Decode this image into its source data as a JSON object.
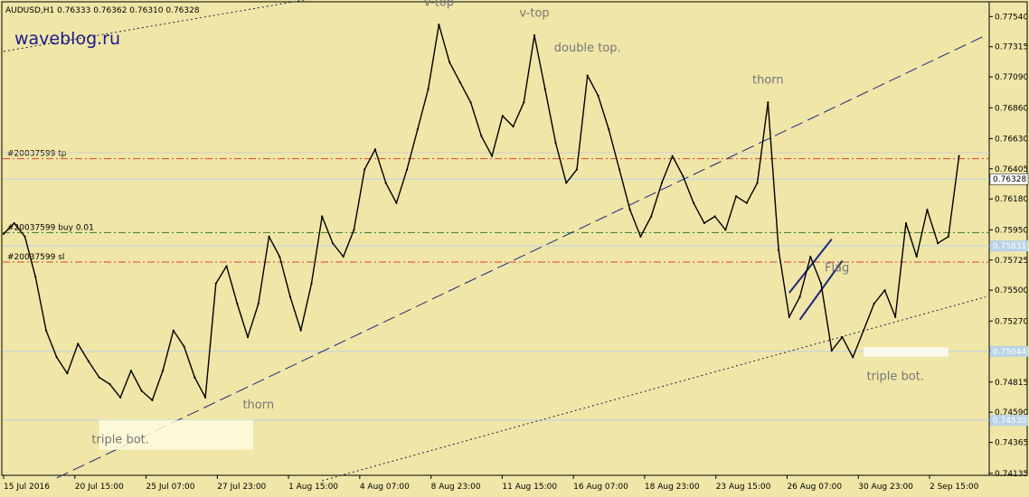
{
  "header": {
    "symbol_line": "AUDUSD,H1  0.76333 0.76362 0.76310 0.76328",
    "watermark": "waveblog.ru"
  },
  "chart_data": {
    "type": "line",
    "title": "AUDUSD,H1",
    "ohlc_last": {
      "open": 0.76333,
      "high": 0.76362,
      "low": 0.7631,
      "close": 0.76328
    },
    "ylim": [
      0.7412,
      0.7765
    ],
    "y_ticks": [
      "0.77540",
      "0.77315",
      "0.77090",
      "0.76860",
      "0.76630",
      "0.76405",
      "0.76180",
      "0.75950",
      "0.75725",
      "0.75500",
      "0.75270",
      "0.75045",
      "0.74815",
      "0.74590",
      "0.74365",
      "0.74135"
    ],
    "x_ticks": [
      "15 Jul 2016",
      "20 Jul 15:00",
      "25 Jul 07:00",
      "27 Jul 23:00",
      "1 Aug 15:00",
      "4 Aug 07:00",
      "8 Aug 23:00",
      "11 Aug 15:00",
      "16 Aug 07:00",
      "18 Aug 23:00",
      "23 Aug 15:00",
      "26 Aug 07:00",
      "30 Aug 23:00",
      "2 Sep 15:00"
    ],
    "price_series": [
      {
        "t": 0,
        "v": 0.7592
      },
      {
        "t": 2,
        "v": 0.76
      },
      {
        "t": 4,
        "v": 0.759
      },
      {
        "t": 6,
        "v": 0.756
      },
      {
        "t": 8,
        "v": 0.752
      },
      {
        "t": 10,
        "v": 0.75
      },
      {
        "t": 12,
        "v": 0.7488
      },
      {
        "t": 14,
        "v": 0.751
      },
      {
        "t": 16,
        "v": 0.7497
      },
      {
        "t": 18,
        "v": 0.7485
      },
      {
        "t": 20,
        "v": 0.748
      },
      {
        "t": 22,
        "v": 0.747
      },
      {
        "t": 24,
        "v": 0.749
      },
      {
        "t": 26,
        "v": 0.7475
      },
      {
        "t": 28,
        "v": 0.7468
      },
      {
        "t": 30,
        "v": 0.749
      },
      {
        "t": 32,
        "v": 0.752
      },
      {
        "t": 34,
        "v": 0.7508
      },
      {
        "t": 36,
        "v": 0.7485
      },
      {
        "t": 38,
        "v": 0.747
      },
      {
        "t": 40,
        "v": 0.7555
      },
      {
        "t": 42,
        "v": 0.7568
      },
      {
        "t": 44,
        "v": 0.754
      },
      {
        "t": 46,
        "v": 0.7515
      },
      {
        "t": 48,
        "v": 0.754
      },
      {
        "t": 50,
        "v": 0.759
      },
      {
        "t": 52,
        "v": 0.7575
      },
      {
        "t": 54,
        "v": 0.7545
      },
      {
        "t": 56,
        "v": 0.752
      },
      {
        "t": 58,
        "v": 0.7555
      },
      {
        "t": 60,
        "v": 0.7605
      },
      {
        "t": 62,
        "v": 0.7585
      },
      {
        "t": 64,
        "v": 0.7575
      },
      {
        "t": 66,
        "v": 0.7595
      },
      {
        "t": 68,
        "v": 0.764
      },
      {
        "t": 70,
        "v": 0.7655
      },
      {
        "t": 72,
        "v": 0.763
      },
      {
        "t": 74,
        "v": 0.7615
      },
      {
        "t": 76,
        "v": 0.764
      },
      {
        "t": 78,
        "v": 0.767
      },
      {
        "t": 80,
        "v": 0.77
      },
      {
        "t": 82,
        "v": 0.7748
      },
      {
        "t": 84,
        "v": 0.772
      },
      {
        "t": 86,
        "v": 0.7705
      },
      {
        "t": 88,
        "v": 0.769
      },
      {
        "t": 90,
        "v": 0.7665
      },
      {
        "t": 92,
        "v": 0.765
      },
      {
        "t": 94,
        "v": 0.768
      },
      {
        "t": 96,
        "v": 0.7672
      },
      {
        "t": 98,
        "v": 0.769
      },
      {
        "t": 100,
        "v": 0.774
      },
      {
        "t": 102,
        "v": 0.77
      },
      {
        "t": 104,
        "v": 0.766
      },
      {
        "t": 106,
        "v": 0.763
      },
      {
        "t": 108,
        "v": 0.764
      },
      {
        "t": 110,
        "v": 0.771
      },
      {
        "t": 112,
        "v": 0.7695
      },
      {
        "t": 114,
        "v": 0.767
      },
      {
        "t": 116,
        "v": 0.764
      },
      {
        "t": 118,
        "v": 0.761
      },
      {
        "t": 120,
        "v": 0.759
      },
      {
        "t": 122,
        "v": 0.7605
      },
      {
        "t": 124,
        "v": 0.763
      },
      {
        "t": 126,
        "v": 0.765
      },
      {
        "t": 128,
        "v": 0.7635
      },
      {
        "t": 130,
        "v": 0.7615
      },
      {
        "t": 132,
        "v": 0.76
      },
      {
        "t": 134,
        "v": 0.7605
      },
      {
        "t": 136,
        "v": 0.7595
      },
      {
        "t": 138,
        "v": 0.762
      },
      {
        "t": 140,
        "v": 0.7615
      },
      {
        "t": 142,
        "v": 0.763
      },
      {
        "t": 144,
        "v": 0.769
      },
      {
        "t": 146,
        "v": 0.758
      },
      {
        "t": 148,
        "v": 0.753
      },
      {
        "t": 150,
        "v": 0.7545
      },
      {
        "t": 152,
        "v": 0.7575
      },
      {
        "t": 154,
        "v": 0.7555
      },
      {
        "t": 156,
        "v": 0.7505
      },
      {
        "t": 158,
        "v": 0.7515
      },
      {
        "t": 160,
        "v": 0.75
      },
      {
        "t": 162,
        "v": 0.752
      },
      {
        "t": 164,
        "v": 0.754
      },
      {
        "t": 166,
        "v": 0.755
      },
      {
        "t": 168,
        "v": 0.753
      },
      {
        "t": 170,
        "v": 0.76
      },
      {
        "t": 172,
        "v": 0.7575
      },
      {
        "t": 174,
        "v": 0.761
      },
      {
        "t": 176,
        "v": 0.7585
      },
      {
        "t": 178,
        "v": 0.759
      },
      {
        "t": 180,
        "v": 0.765
      }
    ],
    "horizontal_lines": [
      {
        "label": "#20037599 tp",
        "value": 0.7648,
        "color": "#d64532",
        "style": "dashdot"
      },
      {
        "label": "",
        "value": 0.76525,
        "color": "#cfcfcf",
        "style": "solid"
      },
      {
        "label": "",
        "value": 0.76328,
        "color": "#b9d3e6",
        "style": "solid"
      },
      {
        "label": "#20037599 buy 0.01",
        "value": 0.7593,
        "color": "#2d7d2d",
        "style": "dashdot"
      },
      {
        "label": "",
        "value": 0.7583,
        "color": "#b9d3e6",
        "style": "solid"
      },
      {
        "label": "#20037599 sl",
        "value": 0.7571,
        "color": "#d64532",
        "style": "dashdot"
      },
      {
        "label": "",
        "value": 0.75044,
        "color": "#b9d3e6",
        "style": "solid"
      },
      {
        "label": "",
        "value": 0.7453,
        "color": "#b9d3e6",
        "style": "solid"
      }
    ],
    "price_tags": [
      {
        "text": "0.76328",
        "value": 0.76328,
        "bg": "#ffffff",
        "fg": "#000000"
      },
      {
        "text": "0.75831",
        "value": 0.7583,
        "bg": "#b9d3e6",
        "fg": "#ffffff"
      },
      {
        "text": "0.75044",
        "value": 0.75044,
        "bg": "#b9d3e6",
        "fg": "#ffffff"
      },
      {
        "text": "0.74530",
        "value": 0.7453,
        "bg": "#b9d3e6",
        "fg": "#ffffff"
      }
    ],
    "annotations": [
      {
        "text": "v-top",
        "t": 82,
        "v": 0.7762
      },
      {
        "text": "v-top",
        "t": 100,
        "v": 0.7754
      },
      {
        "text": "double top.",
        "t": 110,
        "v": 0.7728
      },
      {
        "text": "thorn",
        "t": 144,
        "v": 0.7704
      },
      {
        "text": "thorn",
        "t": 48,
        "v": 0.7462
      },
      {
        "text": "Flag",
        "t": 157,
        "v": 0.7564
      },
      {
        "text": "triple bot.",
        "t": 168,
        "v": 0.7483
      },
      {
        "text": "triple bot.",
        "t": 22,
        "v": 0.7436
      }
    ],
    "trendlines": [
      {
        "name": "upper-dotted",
        "style": "dotted",
        "color": "#222244",
        "points": [
          [
            0,
            0.7728
          ],
          [
            62,
            0.777
          ]
        ]
      },
      {
        "name": "long-dashed",
        "style": "dashed",
        "color": "#1d2a7a",
        "points": [
          [
            10,
            0.741
          ],
          [
            185,
            0.774
          ]
        ]
      },
      {
        "name": "lower-dotted",
        "style": "dotted",
        "color": "#222244",
        "points": [
          [
            60,
            0.7408
          ],
          [
            185,
            0.7545
          ]
        ]
      },
      {
        "name": "flag-upper",
        "style": "solid",
        "color": "#1d2a7a",
        "points": [
          [
            148,
            0.7548
          ],
          [
            156,
            0.7588
          ]
        ]
      },
      {
        "name": "flag-lower",
        "style": "solid",
        "color": "#1d2a7a",
        "points": [
          [
            150,
            0.7528
          ],
          [
            158,
            0.7572
          ]
        ]
      }
    ]
  }
}
